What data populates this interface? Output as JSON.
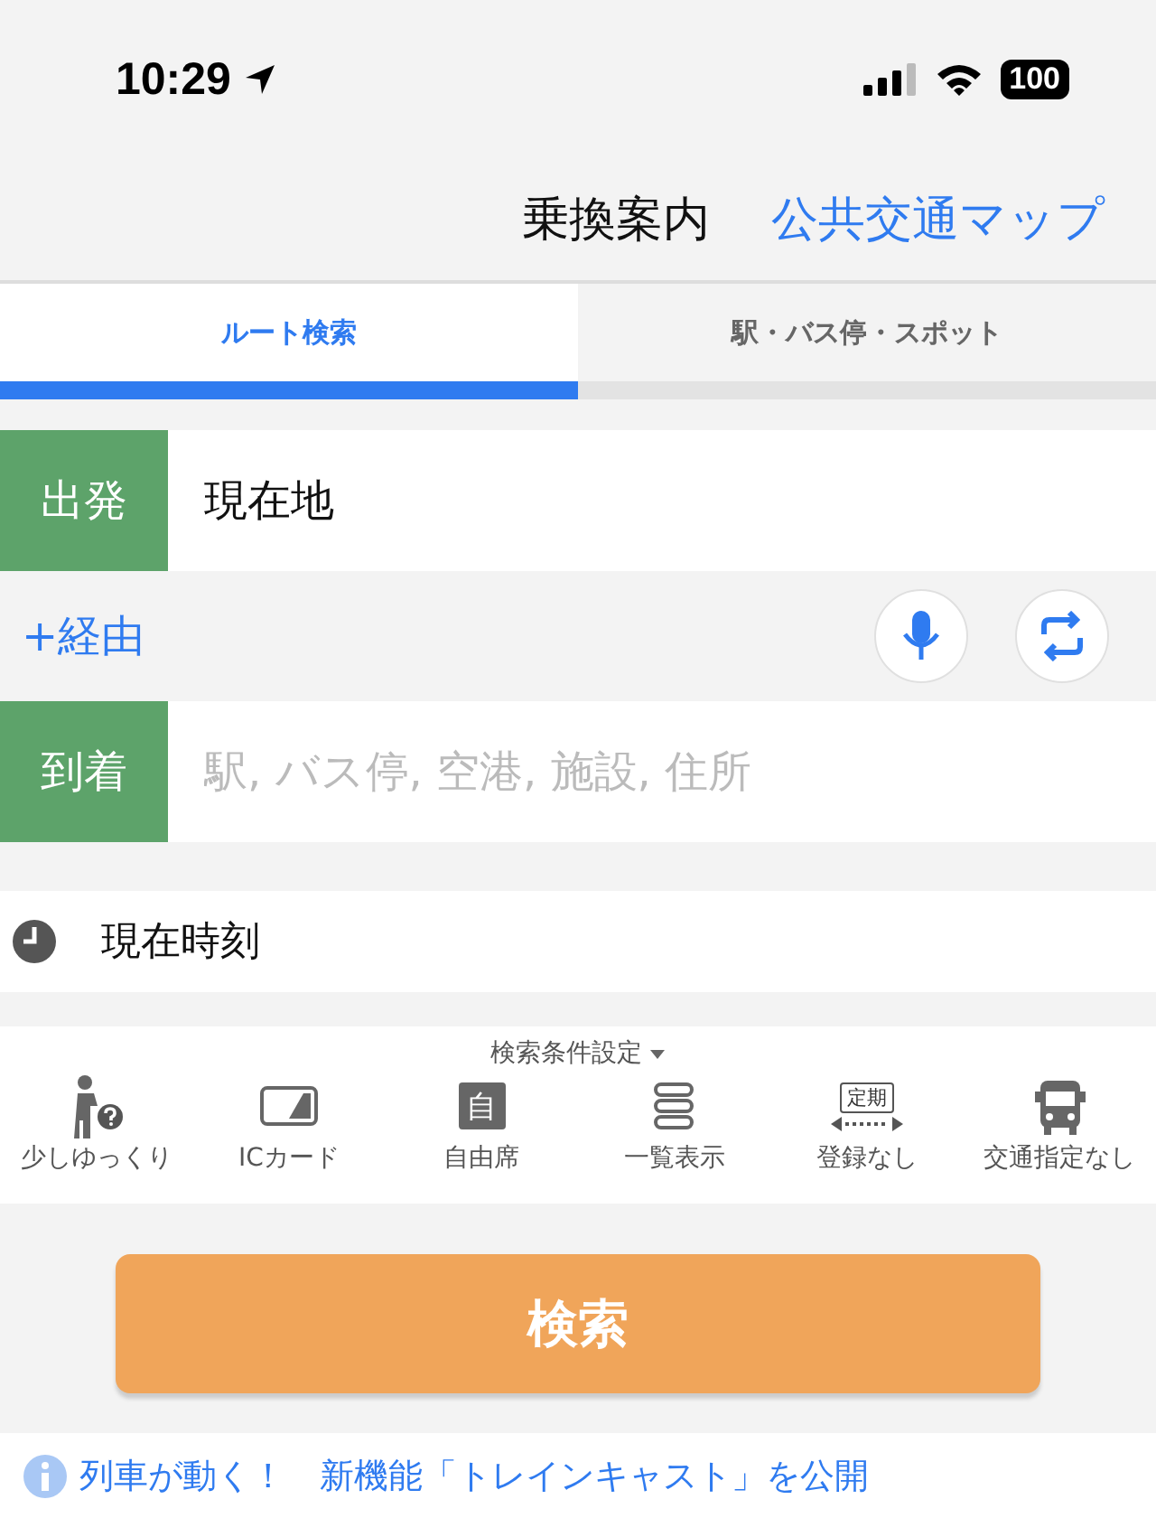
{
  "status_bar": {
    "time": "10:29",
    "battery": "100"
  },
  "header": {
    "title": "乗換案内",
    "map_link": "公共交通マップ"
  },
  "tabs": [
    {
      "label": "ルート検索",
      "selected": true
    },
    {
      "label": "駅・バス停・スポット",
      "selected": false
    }
  ],
  "departure": {
    "label": "出発",
    "value": "現在地"
  },
  "via": {
    "label": "+経由"
  },
  "arrival": {
    "label": "到着",
    "placeholder": "駅, バス停, 空港, 施設, 住所"
  },
  "time": {
    "value": "現在時刻"
  },
  "conditions": {
    "title": "検索条件設定",
    "options": [
      {
        "kind": "walk",
        "label": "少しゆっくり"
      },
      {
        "kind": "card",
        "label": "ICカード"
      },
      {
        "kind": "seat",
        "label": "自由席",
        "icon_text": "自"
      },
      {
        "kind": "list",
        "label": "一覧表示"
      },
      {
        "kind": "pass",
        "label": "登録なし",
        "icon_text": "定期"
      },
      {
        "kind": "bus",
        "label": "交通指定なし"
      }
    ]
  },
  "search_button": "検索",
  "notice": "列車が動く！　新機能「トレインキャスト」を公開"
}
